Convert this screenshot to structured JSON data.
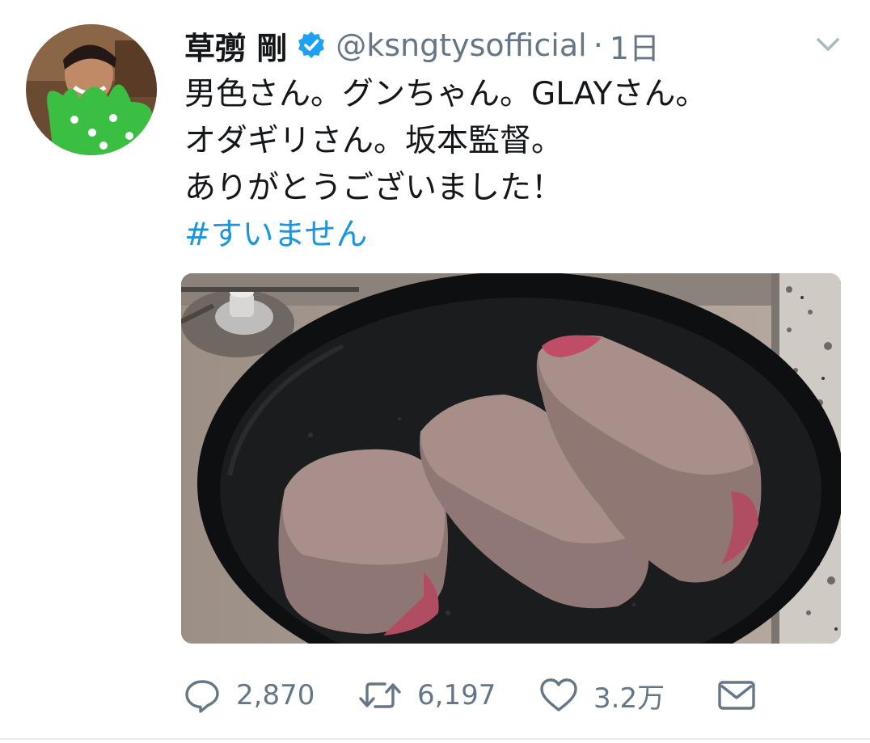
{
  "author": {
    "display_name": "草彅 剛",
    "handle": "@ksngtysofficial",
    "separator": "·",
    "time": "1日"
  },
  "tweet": {
    "lines": [
      "男色さん。グンちゃん。GLAYさん。",
      "オダギリさん。坂本監督。",
      "ありがとうございました！"
    ],
    "hashtag": "#すいません"
  },
  "actions": {
    "reply_count": "2,870",
    "retweet_count": "6,197",
    "like_count": "3.2万"
  },
  "icons": {
    "verified": "verified-badge-icon",
    "menu": "chevron-down-icon",
    "reply": "reply-icon",
    "retweet": "retweet-icon",
    "like": "heart-icon",
    "dm": "envelope-icon"
  },
  "colors": {
    "link": "#1b95e0",
    "secondary_text": "#657786",
    "primary_text": "#14171a",
    "verified": "#1da1f2"
  }
}
